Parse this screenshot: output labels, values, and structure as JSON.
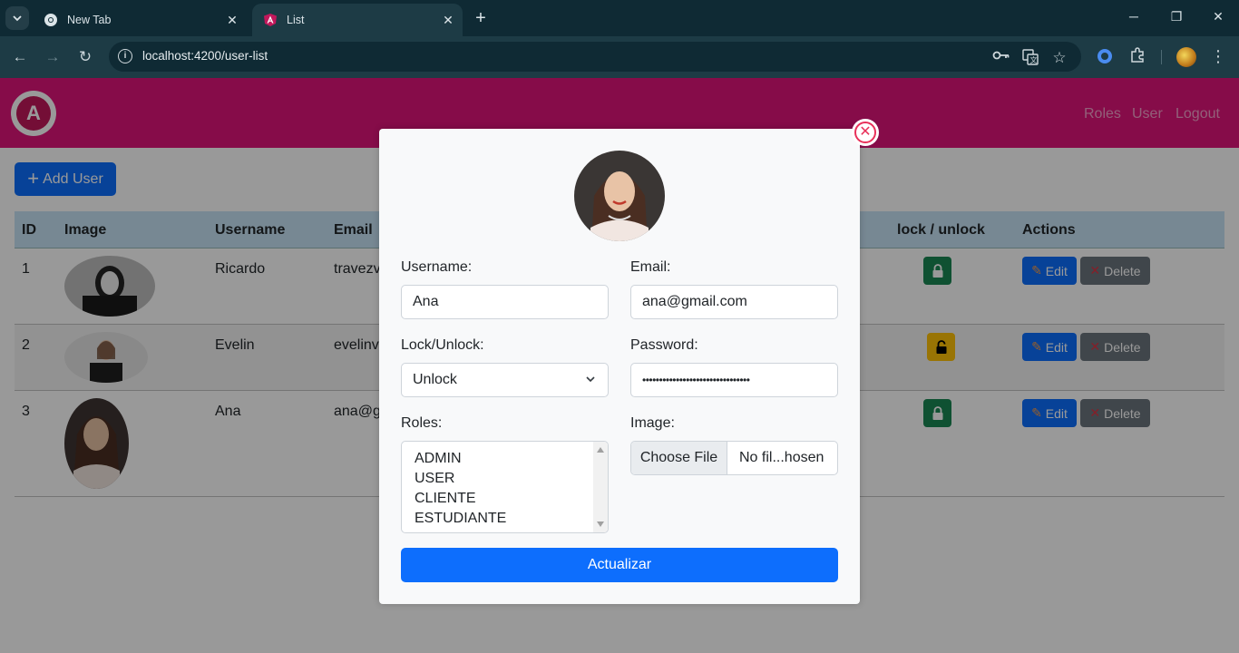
{
  "browser": {
    "tabs": [
      {
        "title": "New Tab",
        "active": false
      },
      {
        "title": "List",
        "active": true
      }
    ],
    "url": "localhost:4200/user-list"
  },
  "app": {
    "nav": [
      "Roles",
      "User",
      "Logout"
    ],
    "add_user_label": "Add User",
    "table": {
      "headers": [
        "ID",
        "Image",
        "Username",
        "Email",
        "lock / unlock",
        "Actions"
      ],
      "rows": [
        {
          "id": "1",
          "username": "Ricardo",
          "email": "travezv",
          "lock": "locked"
        },
        {
          "id": "2",
          "username": "Evelin",
          "email": "evelinv",
          "lock": "unlocked"
        },
        {
          "id": "3",
          "username": "Ana",
          "email": "ana@g",
          "lock": "locked"
        }
      ],
      "edit_label": "Edit",
      "delete_label": "Delete"
    }
  },
  "modal": {
    "username_label": "Username:",
    "username_value": "Ana",
    "email_label": "Email:",
    "email_value": "ana@gmail.com",
    "lock_label": "Lock/Unlock:",
    "lock_value": "Unlock",
    "password_label": "Password:",
    "password_value": "••••••••••••••••••••••••••••••••",
    "roles_label": "Roles:",
    "roles_options": [
      "ADMIN",
      "USER",
      "CLIENTE",
      "ESTUDIANTE"
    ],
    "image_label": "Image:",
    "choose_file_label": "Choose File",
    "no_file_label": "No fil...hosen",
    "submit_label": "Actualizar"
  },
  "colors": {
    "appbar": "#e0147a",
    "primary": "#0d6efd",
    "secondary": "#6c757d",
    "success": "#198754",
    "warning": "#ffc107",
    "table_header": "#c7e3f5",
    "close_icon": "#e8315a"
  }
}
